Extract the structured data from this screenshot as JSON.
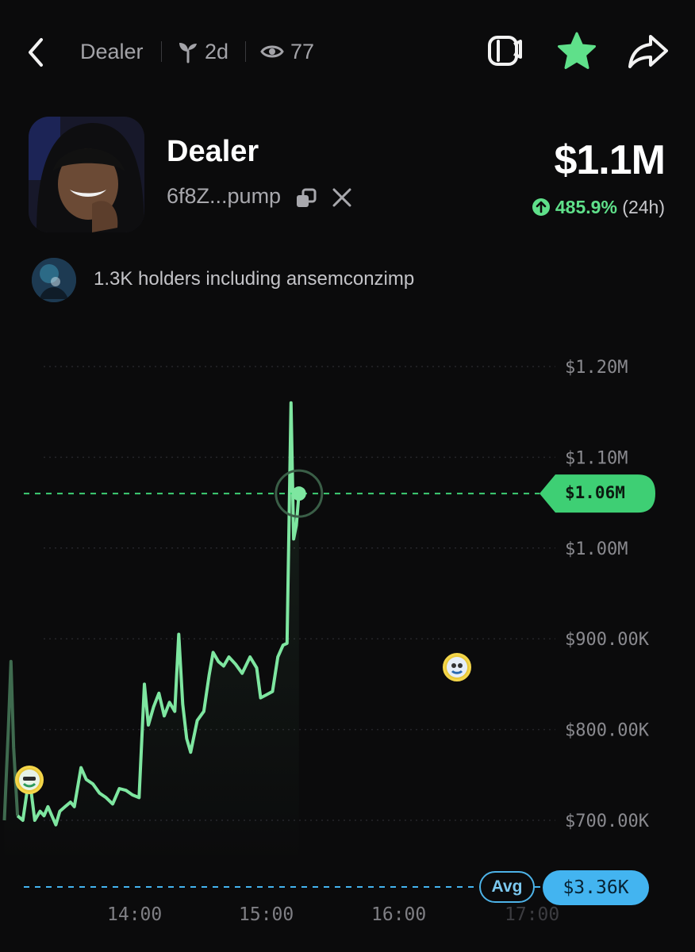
{
  "header": {
    "crumb_name": "Dealer",
    "age": "2d",
    "views": "77",
    "icons": [
      "back-chevron-icon",
      "sprout-icon",
      "eye-icon",
      "chat-icon",
      "star-icon",
      "share-icon"
    ],
    "star_color": "#5fe08a"
  },
  "token": {
    "name": "Dealer",
    "address": "6f8Z...pump",
    "market_cap": "$1.1M",
    "change_pct": "485.9%",
    "change_period": "(24h)",
    "change_color": "#5fe08a"
  },
  "holders": {
    "text": "1.3K holders including ansemconzimp"
  },
  "chart": {
    "current_price_label": "$1.06M",
    "avg_label": "Avg",
    "avg_value": "$3.36K",
    "line_color": "#7ee6a0",
    "current_color": "#3ecf74",
    "avg_color": "#43b4f0"
  },
  "chart_data": {
    "type": "line",
    "x_ticks": [
      "14:00",
      "15:00",
      "16:00",
      "17:00"
    ],
    "y_ticks": [
      "$1.20M",
      "$1.10M",
      "$1.00M",
      "$900.00K",
      "$800.00K",
      "$700.00K"
    ],
    "current_value": 1060000,
    "series": [
      {
        "values": [
          [
            13.0,
            700000
          ],
          [
            13.03,
            800000
          ],
          [
            13.05,
            875000
          ],
          [
            13.07,
            780000
          ],
          [
            13.1,
            705000
          ],
          [
            13.14,
            700000
          ],
          [
            13.17,
            730000
          ],
          [
            13.2,
            735000
          ],
          [
            13.23,
            700000
          ],
          [
            13.27,
            710000
          ],
          [
            13.3,
            705000
          ],
          [
            13.33,
            715000
          ],
          [
            13.36,
            705000
          ],
          [
            13.39,
            695000
          ],
          [
            13.42,
            710000
          ],
          [
            13.46,
            715000
          ],
          [
            13.5,
            720000
          ],
          [
            13.53,
            715000
          ],
          [
            13.58,
            758000
          ],
          [
            13.62,
            745000
          ],
          [
            13.67,
            740000
          ],
          [
            13.72,
            730000
          ],
          [
            13.77,
            725000
          ],
          [
            13.82,
            718000
          ],
          [
            13.87,
            735000
          ],
          [
            13.92,
            733000
          ],
          [
            13.97,
            728000
          ],
          [
            14.02,
            725000
          ],
          [
            14.06,
            850000
          ],
          [
            14.09,
            805000
          ],
          [
            14.13,
            825000
          ],
          [
            14.17,
            840000
          ],
          [
            14.21,
            815000
          ],
          [
            14.25,
            830000
          ],
          [
            14.29,
            820000
          ],
          [
            14.32,
            905000
          ],
          [
            14.35,
            828000
          ],
          [
            14.38,
            790000
          ],
          [
            14.41,
            775000
          ],
          [
            14.46,
            810000
          ],
          [
            14.51,
            820000
          ],
          [
            14.55,
            860000
          ],
          [
            14.58,
            885000
          ],
          [
            14.62,
            875000
          ],
          [
            14.66,
            870000
          ],
          [
            14.7,
            880000
          ],
          [
            14.75,
            872000
          ],
          [
            14.8,
            862000
          ],
          [
            14.86,
            880000
          ],
          [
            14.91,
            868000
          ],
          [
            14.94,
            835000
          ],
          [
            14.98,
            838000
          ],
          [
            15.03,
            842000
          ],
          [
            15.07,
            880000
          ],
          [
            15.11,
            893000
          ],
          [
            15.14,
            895000
          ],
          [
            15.17,
            1160000
          ],
          [
            15.19,
            1010000
          ],
          [
            15.21,
            1025000
          ],
          [
            15.23,
            1060000
          ]
        ]
      }
    ]
  }
}
